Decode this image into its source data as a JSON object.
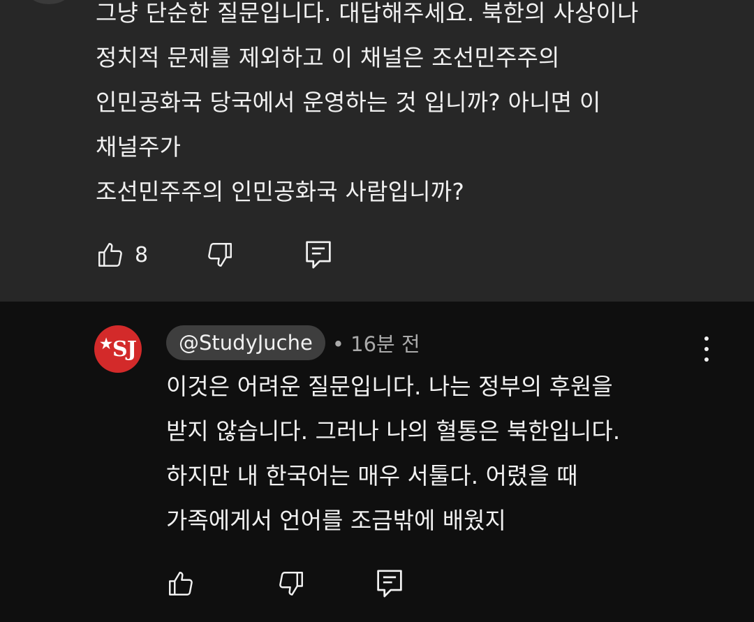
{
  "top_comment": {
    "lines": [
      "그냥 단순한 질문입니다. 대답해주세요. 북한의 사상이나",
      "정치적 문제를 제외하고 이 채널은 조선민주주의",
      "인민공화국 당국에서 운영하는 것 입니까? 아니면 이",
      "채널주가",
      "조선민주주의 인민공화국 사람입니까?"
    ],
    "like_count": "8"
  },
  "reply": {
    "avatar_text": "SJ",
    "avatar_star": "★",
    "avatar_color": "#d32a2a",
    "handle": "@StudyJuche",
    "time": "• 16분 전",
    "lines": [
      "이것은 어려운 질문입니다. 나는 정부의 후원을",
      "받지 않습니다. 그러나 나의 혈통은 북한입니다.",
      "하지만 내 한국어는 매우 서툴다. 어렸을 때",
      "가족에게서 언어를 조금밖에 배웠지"
    ]
  },
  "icons": {
    "like": "thumbs-up-icon",
    "dislike": "thumbs-down-icon",
    "reply": "comment-reply-icon",
    "more": "more-vert-icon"
  },
  "colors": {
    "top_bg": "#272727",
    "reply_bg": "#0f0f0f",
    "text": "#f1f1f1",
    "muted": "#aaaaaa"
  }
}
